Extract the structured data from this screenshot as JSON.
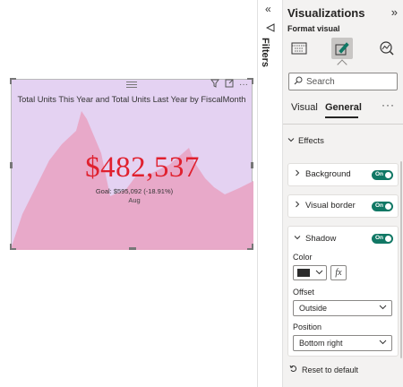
{
  "visual": {
    "title": "Total Units This Year and Total Units Last Year by FiscalMonth",
    "kpi_value": "$482,537",
    "goal_text": "Goal: $595,092 (-18.91%)",
    "axis_label": "Aug",
    "header_icons": [
      "filter-icon",
      "focus-mode-icon",
      "more-options-icon"
    ],
    "area_color": "#e8a6c6",
    "kpi_color": "#e0202e",
    "background_color": "#e4d2f2"
  },
  "filters_strip": {
    "label": "Filters",
    "collapse_icon": "double-chevron-left-icon",
    "speaker_icon": "send-icon"
  },
  "pane": {
    "title": "Visualizations",
    "expand_icon": "double-chevron-right-icon",
    "subtitle": "Format visual",
    "icon_buttons": [
      "build-visual-icon",
      "format-visual-icon",
      "analytics-icon"
    ],
    "search_placeholder": "Search",
    "tabs": [
      {
        "label": "Visual",
        "active": false
      },
      {
        "label": "General",
        "active": true
      }
    ],
    "more_label": "···",
    "section": "Effects",
    "cards": {
      "background": {
        "label": "Background",
        "toggle": "On"
      },
      "border": {
        "label": "Visual border",
        "toggle": "On"
      },
      "shadow": {
        "label": "Shadow",
        "toggle": "On",
        "color_label": "Color",
        "color_value": "#2b2b2b",
        "fx_label": "fx",
        "offset_label": "Offset",
        "offset_value": "Outside",
        "position_label": "Position",
        "position_value": "Bottom right"
      }
    },
    "reset_label": "Reset to default",
    "accent_color": "#117865"
  }
}
